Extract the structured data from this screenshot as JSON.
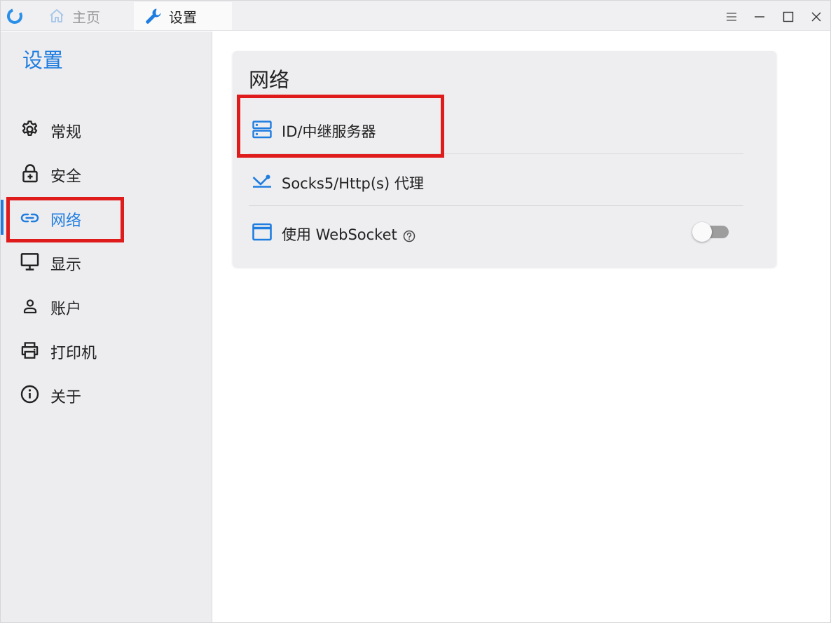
{
  "titlebar": {
    "tabs": [
      {
        "label": "主页",
        "icon": "home-icon",
        "active": false
      },
      {
        "label": "设置",
        "icon": "wrench-icon",
        "active": true
      }
    ]
  },
  "sidebar": {
    "title": "设置",
    "items": [
      {
        "label": "常规",
        "icon": "gear-icon"
      },
      {
        "label": "安全",
        "icon": "lock-icon"
      },
      {
        "label": "网络",
        "icon": "link-icon",
        "active": true
      },
      {
        "label": "显示",
        "icon": "monitor-icon"
      },
      {
        "label": "账户",
        "icon": "person-icon"
      },
      {
        "label": "打印机",
        "icon": "printer-icon"
      },
      {
        "label": "关于",
        "icon": "info-icon"
      }
    ]
  },
  "network_card": {
    "title": "网络",
    "rows": [
      {
        "label": "ID/中继服务器",
        "icon": "server-icon"
      },
      {
        "label": "Socks5/Http(s) 代理",
        "icon": "proxy-icon"
      },
      {
        "label": "使用 WebSocket",
        "icon": "window-icon",
        "help_icon": "help-circle-icon",
        "toggle_on": false
      }
    ]
  },
  "colors": {
    "accent": "#1f7de0",
    "highlight_box": "#e01b1b",
    "sidebar_bg": "#ededf0",
    "card_bg": "#eeeef1"
  }
}
